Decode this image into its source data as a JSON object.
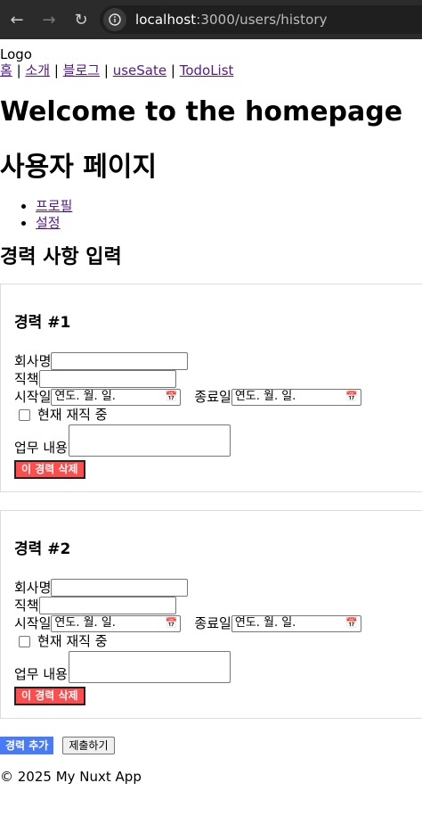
{
  "browser": {
    "url_host": "localhost",
    "url_path": ":3000/users/history"
  },
  "site": {
    "logo": "Logo",
    "nav": [
      "홈",
      "소개",
      "블로그",
      "useSate",
      "TodoList"
    ],
    "separator": "|",
    "welcome": "Welcome to the homepage",
    "user_title": "사용자 페이지",
    "submenu": [
      "프로필",
      "설정"
    ],
    "form_title": "경력 사항 입력"
  },
  "careers": [
    {
      "title": "경력 #1",
      "company_label": "회사명",
      "company_value": "",
      "position_label": "직책",
      "position_value": "",
      "start_label": "시작일",
      "start_placeholder": "연도. 월. 일.",
      "end_label": "종료일",
      "end_placeholder": "연도. 월. 일.",
      "current_label": "현재 재직 중",
      "duties_label": "업무 내용",
      "delete_label": "이 경력 삭제"
    },
    {
      "title": "경력 #2",
      "company_label": "회사명",
      "company_value": "",
      "position_label": "직책",
      "position_value": "",
      "start_label": "시작일",
      "start_placeholder": "연도. 월. 일.",
      "end_label": "종료일",
      "end_placeholder": "연도. 월. 일.",
      "current_label": "현재 재직 중",
      "duties_label": "업무 내용",
      "delete_label": "이 경력 삭제"
    }
  ],
  "actions": {
    "add_label": "경력 추가",
    "submit_label": "제출하기"
  },
  "footer": {
    "text": "© 2025 My Nuxt App"
  },
  "colors": {
    "chrome_bg": "#2b2b2c",
    "delete_btn": "#ff4c4c",
    "add_btn": "#4a7bf7",
    "link": "#551a8b"
  }
}
